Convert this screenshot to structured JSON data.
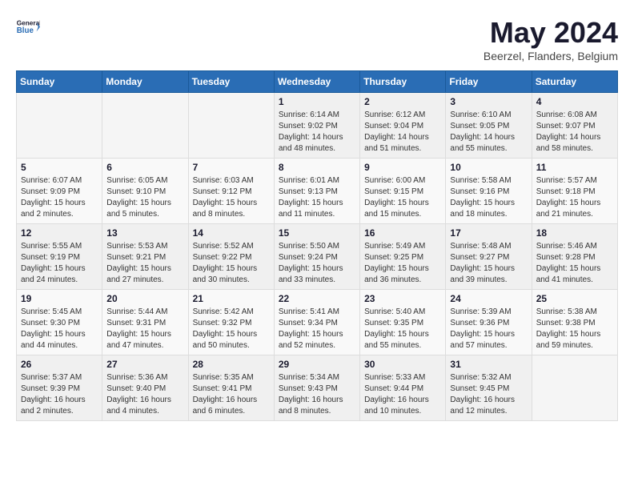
{
  "header": {
    "logo_line1": "General",
    "logo_line2": "Blue",
    "month_year": "May 2024",
    "location": "Beerzel, Flanders, Belgium"
  },
  "weekdays": [
    "Sunday",
    "Monday",
    "Tuesday",
    "Wednesday",
    "Thursday",
    "Friday",
    "Saturday"
  ],
  "weeks": [
    [
      {
        "day": "",
        "info": "",
        "empty": true
      },
      {
        "day": "",
        "info": "",
        "empty": true
      },
      {
        "day": "",
        "info": "",
        "empty": true
      },
      {
        "day": "1",
        "info": "Sunrise: 6:14 AM\nSunset: 9:02 PM\nDaylight: 14 hours\nand 48 minutes."
      },
      {
        "day": "2",
        "info": "Sunrise: 6:12 AM\nSunset: 9:04 PM\nDaylight: 14 hours\nand 51 minutes."
      },
      {
        "day": "3",
        "info": "Sunrise: 6:10 AM\nSunset: 9:05 PM\nDaylight: 14 hours\nand 55 minutes."
      },
      {
        "day": "4",
        "info": "Sunrise: 6:08 AM\nSunset: 9:07 PM\nDaylight: 14 hours\nand 58 minutes."
      }
    ],
    [
      {
        "day": "5",
        "info": "Sunrise: 6:07 AM\nSunset: 9:09 PM\nDaylight: 15 hours\nand 2 minutes."
      },
      {
        "day": "6",
        "info": "Sunrise: 6:05 AM\nSunset: 9:10 PM\nDaylight: 15 hours\nand 5 minutes."
      },
      {
        "day": "7",
        "info": "Sunrise: 6:03 AM\nSunset: 9:12 PM\nDaylight: 15 hours\nand 8 minutes."
      },
      {
        "day": "8",
        "info": "Sunrise: 6:01 AM\nSunset: 9:13 PM\nDaylight: 15 hours\nand 11 minutes."
      },
      {
        "day": "9",
        "info": "Sunrise: 6:00 AM\nSunset: 9:15 PM\nDaylight: 15 hours\nand 15 minutes."
      },
      {
        "day": "10",
        "info": "Sunrise: 5:58 AM\nSunset: 9:16 PM\nDaylight: 15 hours\nand 18 minutes."
      },
      {
        "day": "11",
        "info": "Sunrise: 5:57 AM\nSunset: 9:18 PM\nDaylight: 15 hours\nand 21 minutes."
      }
    ],
    [
      {
        "day": "12",
        "info": "Sunrise: 5:55 AM\nSunset: 9:19 PM\nDaylight: 15 hours\nand 24 minutes."
      },
      {
        "day": "13",
        "info": "Sunrise: 5:53 AM\nSunset: 9:21 PM\nDaylight: 15 hours\nand 27 minutes."
      },
      {
        "day": "14",
        "info": "Sunrise: 5:52 AM\nSunset: 9:22 PM\nDaylight: 15 hours\nand 30 minutes."
      },
      {
        "day": "15",
        "info": "Sunrise: 5:50 AM\nSunset: 9:24 PM\nDaylight: 15 hours\nand 33 minutes."
      },
      {
        "day": "16",
        "info": "Sunrise: 5:49 AM\nSunset: 9:25 PM\nDaylight: 15 hours\nand 36 minutes."
      },
      {
        "day": "17",
        "info": "Sunrise: 5:48 AM\nSunset: 9:27 PM\nDaylight: 15 hours\nand 39 minutes."
      },
      {
        "day": "18",
        "info": "Sunrise: 5:46 AM\nSunset: 9:28 PM\nDaylight: 15 hours\nand 41 minutes."
      }
    ],
    [
      {
        "day": "19",
        "info": "Sunrise: 5:45 AM\nSunset: 9:30 PM\nDaylight: 15 hours\nand 44 minutes."
      },
      {
        "day": "20",
        "info": "Sunrise: 5:44 AM\nSunset: 9:31 PM\nDaylight: 15 hours\nand 47 minutes."
      },
      {
        "day": "21",
        "info": "Sunrise: 5:42 AM\nSunset: 9:32 PM\nDaylight: 15 hours\nand 50 minutes."
      },
      {
        "day": "22",
        "info": "Sunrise: 5:41 AM\nSunset: 9:34 PM\nDaylight: 15 hours\nand 52 minutes."
      },
      {
        "day": "23",
        "info": "Sunrise: 5:40 AM\nSunset: 9:35 PM\nDaylight: 15 hours\nand 55 minutes."
      },
      {
        "day": "24",
        "info": "Sunrise: 5:39 AM\nSunset: 9:36 PM\nDaylight: 15 hours\nand 57 minutes."
      },
      {
        "day": "25",
        "info": "Sunrise: 5:38 AM\nSunset: 9:38 PM\nDaylight: 15 hours\nand 59 minutes."
      }
    ],
    [
      {
        "day": "26",
        "info": "Sunrise: 5:37 AM\nSunset: 9:39 PM\nDaylight: 16 hours\nand 2 minutes."
      },
      {
        "day": "27",
        "info": "Sunrise: 5:36 AM\nSunset: 9:40 PM\nDaylight: 16 hours\nand 4 minutes."
      },
      {
        "day": "28",
        "info": "Sunrise: 5:35 AM\nSunset: 9:41 PM\nDaylight: 16 hours\nand 6 minutes."
      },
      {
        "day": "29",
        "info": "Sunrise: 5:34 AM\nSunset: 9:43 PM\nDaylight: 16 hours\nand 8 minutes."
      },
      {
        "day": "30",
        "info": "Sunrise: 5:33 AM\nSunset: 9:44 PM\nDaylight: 16 hours\nand 10 minutes."
      },
      {
        "day": "31",
        "info": "Sunrise: 5:32 AM\nSunset: 9:45 PM\nDaylight: 16 hours\nand 12 minutes."
      },
      {
        "day": "",
        "info": "",
        "empty": true
      }
    ]
  ]
}
